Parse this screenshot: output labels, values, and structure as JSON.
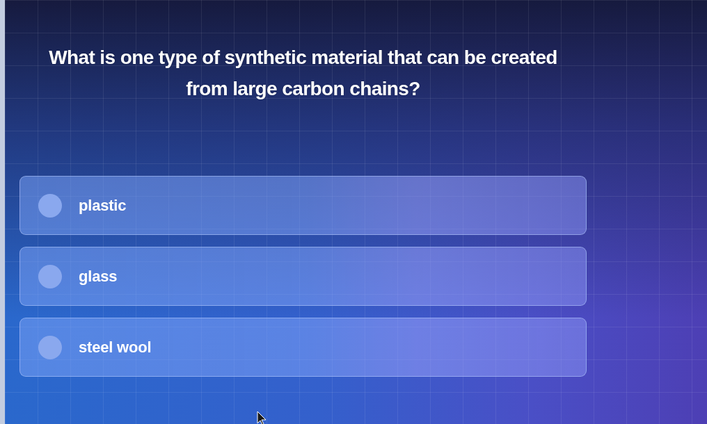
{
  "question": "What is one type of synthetic material that can be created from large carbon chains?",
  "options": [
    {
      "label": "plastic",
      "selected": false
    },
    {
      "label": "glass",
      "selected": false
    },
    {
      "label": "steel wool",
      "selected": false
    }
  ]
}
